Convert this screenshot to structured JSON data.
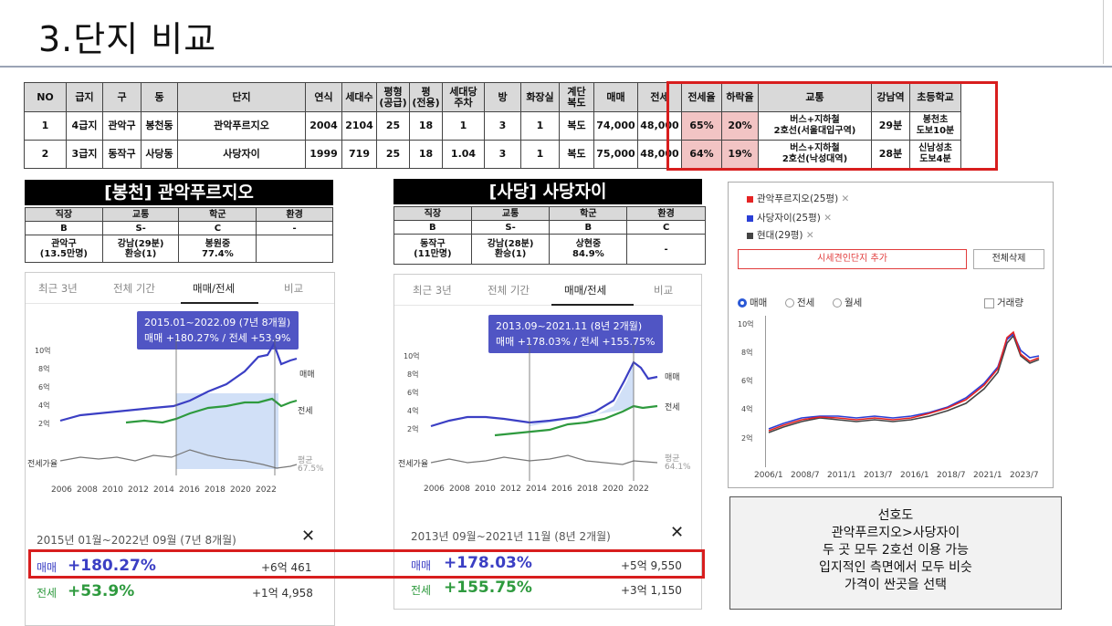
{
  "slide": {
    "title": "3.단지 비교"
  },
  "compare_table": {
    "headers": [
      "NO",
      "급지",
      "구",
      "동",
      "단지",
      "연식",
      "세대수",
      "평형\n(공급)",
      "평\n(전용)",
      "세대당\n주차",
      "방",
      "화장실",
      "계단\n복도",
      "매매",
      "전세",
      "전세율",
      "하락율",
      "교통",
      "강남역",
      "초등학교"
    ],
    "rows": [
      [
        "1",
        "4급지",
        "관악구",
        "봉천동",
        "관악푸르지오",
        "2004",
        "2104",
        "25",
        "18",
        "1",
        "3",
        "1",
        "복도",
        "74,000",
        "48,000",
        "65%",
        "20%",
        "버스+지하철\n2호선(서울대입구역)",
        "29분",
        "봉천초\n도보10분"
      ],
      [
        "2",
        "3급지",
        "동작구",
        "사당동",
        "사당자이",
        "1999",
        "719",
        "25",
        "18",
        "1.04",
        "3",
        "1",
        "복도",
        "75,000",
        "48,000",
        "64%",
        "19%",
        "버스+지하철\n2호선(낙성대역)",
        "28분",
        "신남성초\n도보4분"
      ]
    ]
  },
  "left_card": {
    "heading": "[봉천] 관악푸르지오",
    "info_headers": [
      "직장",
      "교통",
      "학군",
      "환경"
    ],
    "grades": [
      "B",
      "S-",
      "C",
      "-"
    ],
    "details": [
      "관악구\n(13.5만명)",
      "강남(29분)\n환승(1)",
      "봉원중\n77.4%",
      ""
    ],
    "tabs": [
      "최근 3년",
      "전체 기간",
      "매매/전세",
      "비교"
    ],
    "tooltip_line1": "2015.01~2022.09 (7년 8개월)",
    "tooltip_line2": "매매 +180.27%  /  전세 +53.9%",
    "period": "2015년 01월~2022년 09월 (7년 8개월)",
    "sale_label": "매매",
    "sale_pct": "+180.27%",
    "sale_amt": "+6억 461",
    "jeonse_label": "전세",
    "jeonse_pct": "+53.9%",
    "jeonse_amt": "+1억 4,958",
    "ratio_avg": "67.5%"
  },
  "right_card": {
    "heading": "[사당] 사당자이",
    "info_headers": [
      "직장",
      "교통",
      "학군",
      "환경"
    ],
    "grades": [
      "B",
      "S-",
      "B",
      "C"
    ],
    "details": [
      "동작구\n(11만명)",
      "강남(28분)\n환승(1)",
      "상현중\n84.9%",
      "-"
    ],
    "tabs": [
      "최근 3년",
      "전체 기간",
      "매매/전세",
      "비교"
    ],
    "tooltip_line1": "2013.09~2021.11 (8년 2개월)",
    "tooltip_line2": "매매 +178.03%  /  전세 +155.75%",
    "period": "2013년 09월~2021년 11월 (8년 2개월)",
    "sale_label": "매매",
    "sale_pct": "+178.03%",
    "sale_amt": "+5억 9,550",
    "jeonse_label": "전세",
    "jeonse_pct": "+155.75%",
    "jeonse_amt": "+3억 1,150",
    "ratio_avg": "64.1%"
  },
  "mini_chart_labels": {
    "y_ticks": [
      "10억",
      "8억",
      "6억",
      "4억",
      "2억"
    ],
    "x_ticks": [
      "2006",
      "2008",
      "2010",
      "2012",
      "2014",
      "2016",
      "2018",
      "2020",
      "2022"
    ],
    "sale_legend": "매매",
    "jeonse_legend": "전세",
    "ratio_label": "전세가율",
    "avg_label": "평균"
  },
  "graph_panel": {
    "legend": [
      {
        "name": "관악푸르지오(25평)",
        "color": "#e52424"
      },
      {
        "name": "사당자이(25평)",
        "color": "#2a3fd6"
      },
      {
        "name": "현대(29평)",
        "color": "#444444"
      }
    ],
    "add_button": "시세견인단지 추가",
    "delete_button": "전체삭제",
    "radios": [
      "매매",
      "전세",
      "월세"
    ],
    "checkbox": "거래량",
    "y_ticks": [
      "10억",
      "8억",
      "6억",
      "4억",
      "2억"
    ],
    "x_ticks": [
      "2006/1",
      "2008/7",
      "2011/1",
      "2013/7",
      "2016/1",
      "2018/7",
      "2021/1",
      "2023/7"
    ]
  },
  "memo": {
    "lines": [
      "선호도",
      "관악푸르지오>사당자이",
      "두 곳 모두 2호선 이용 가능",
      "입지적인 측면에서 모두 비슷",
      "가격이 싼곳을 선택"
    ]
  },
  "colors": {
    "highlight_red": "#d81e1e",
    "sale_blue": "#3b3fc4",
    "jeonse_green": "#2e9a3e",
    "tooltip": "#5055c4"
  }
}
